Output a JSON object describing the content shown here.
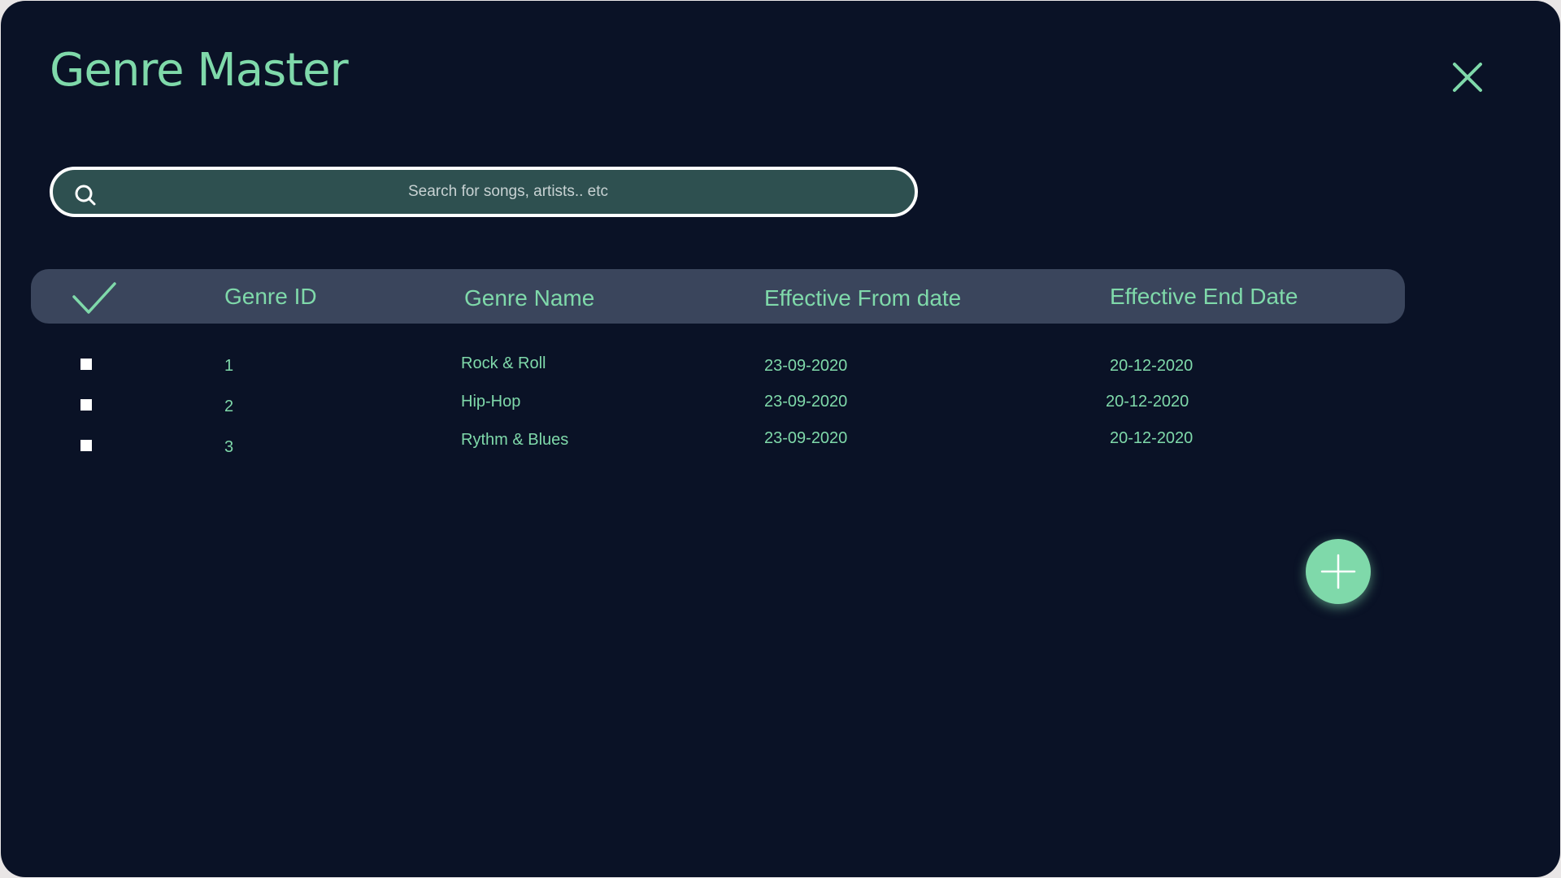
{
  "page": {
    "title": "Genre Master"
  },
  "search": {
    "placeholder": "Search for songs, artists.. etc",
    "value": ""
  },
  "table": {
    "columns": [
      "Genre ID",
      "Genre Name",
      "Effective From date",
      "Effective End Date"
    ],
    "rows": [
      {
        "checked": false,
        "genre_id": "1",
        "genre_name": "Rock & Roll",
        "from_date": "23-09-2020",
        "end_date": "20-12-2020"
      },
      {
        "checked": false,
        "genre_id": "2",
        "genre_name": "Hip-Hop",
        "from_date": "23-09-2020",
        "end_date": "20-12-2020"
      },
      {
        "checked": false,
        "genre_id": "3",
        "genre_name": "Rythm & Blues",
        "from_date": "23-09-2020",
        "end_date": "20-12-2020"
      }
    ]
  },
  "icons": {
    "close": "close-icon",
    "search": "search-icon",
    "select_all": "checkmark-icon",
    "add": "plus-icon"
  },
  "colors": {
    "background": "#0a1226",
    "accent": "#7fd9aa",
    "header_bg": "#3a455c",
    "search_bg": "#2e5050"
  }
}
